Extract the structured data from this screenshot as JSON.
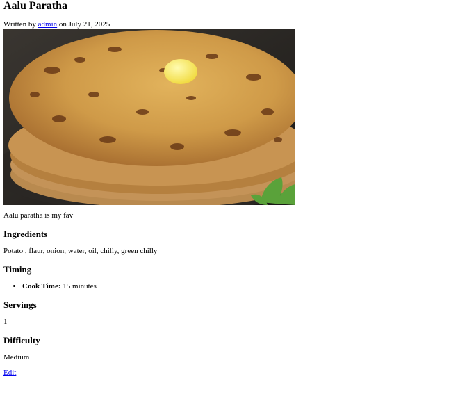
{
  "recipe": {
    "title": "Aalu Paratha",
    "byline_prefix": "Written by ",
    "author": "admin",
    "byline_date": " on July 21, 2025",
    "description": "Aalu paratha is my fav",
    "ingredients_heading": "Ingredients",
    "ingredients": "Potato , flaur, onion, water, oil, chilly, green chilly",
    "timing_heading": "Timing",
    "cook_time_label": "Cook Time:",
    "cook_time_value": " 15 minutes",
    "servings_heading": "Servings",
    "servings": "1",
    "difficulty_heading": "Difficulty",
    "difficulty": "Medium",
    "edit_label": "Edit"
  }
}
